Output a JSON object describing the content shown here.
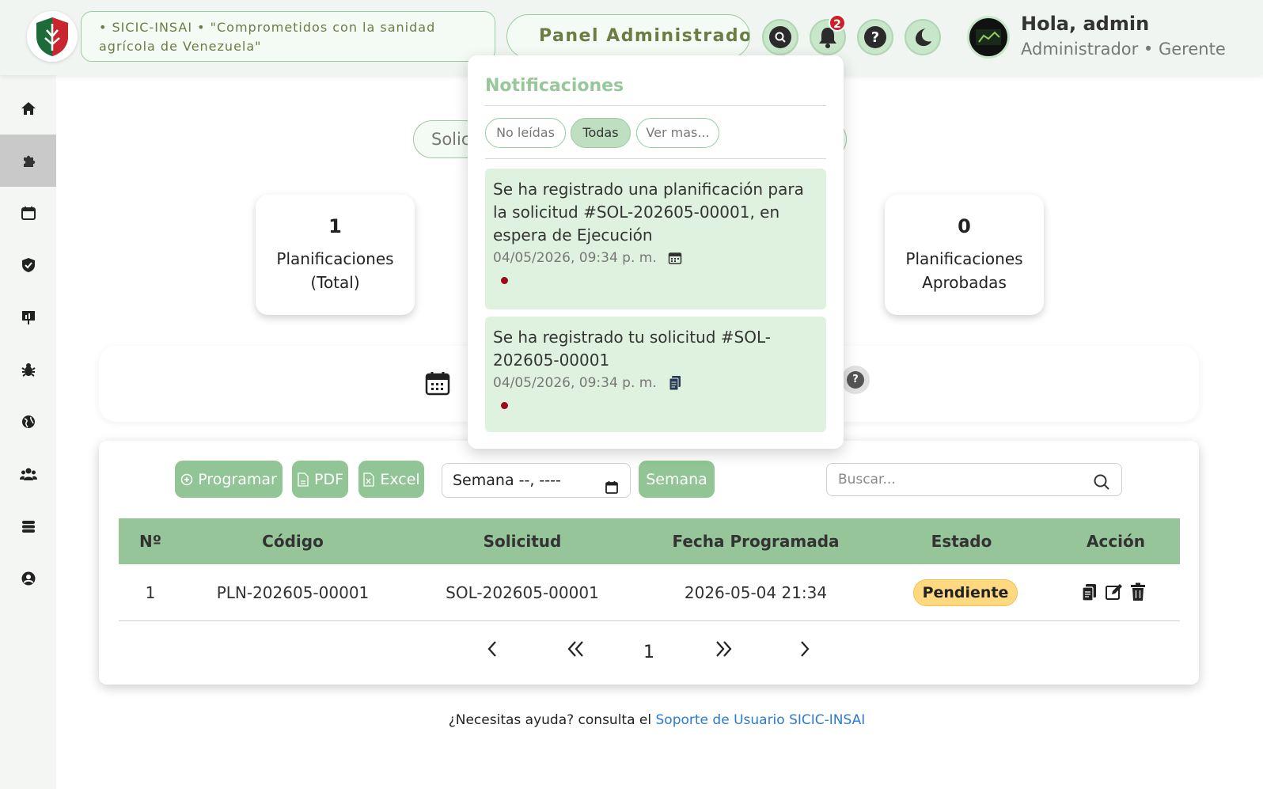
{
  "header": {
    "slogan": "• SICIC-INSAI • \"Comprometidos con la sanidad agrícola de Venezuela\"",
    "panel_title": "Panel Administrador",
    "notification_count": "2",
    "greeting": "Hola, admin",
    "role": "Administrador • Gerente",
    "icons": [
      "search-icon",
      "bell-icon",
      "help-icon",
      "moon-icon"
    ]
  },
  "sidebar": {
    "items": [
      {
        "icon": "home-icon"
      },
      {
        "icon": "puzzle-icon",
        "active": true
      },
      {
        "icon": "calendar-icon"
      },
      {
        "icon": "shield-icon"
      },
      {
        "icon": "presentation-icon"
      },
      {
        "icon": "bug-icon"
      },
      {
        "icon": "globe-icon"
      },
      {
        "icon": "users-icon"
      },
      {
        "icon": "database-icon"
      },
      {
        "icon": "user-circle-icon"
      }
    ]
  },
  "main": {
    "pill_text": "Solic",
    "stats": [
      {
        "value": "1",
        "label_line1": "Planificaciones",
        "label_line2": "(Total)"
      },
      {
        "value": "0",
        "label_line1": "Planificaciones",
        "label_line2": "Aprobadas"
      }
    ]
  },
  "toolbar": {
    "program_label": "Programar",
    "pdf_label": "PDF",
    "excel_label": "Excel",
    "week_value": "Semana --, ----",
    "week_button_label": "Semana",
    "search_placeholder": "Buscar..."
  },
  "table": {
    "headers": [
      "Nº",
      "Código",
      "Solicitud",
      "Fecha Programada",
      "Estado",
      "Acción"
    ],
    "rows": [
      {
        "n": "1",
        "code": "PLN-202605-00001",
        "request": "SOL-202605-00001",
        "date": "2026-05-04 21:34",
        "status": "Pendiente"
      }
    ]
  },
  "pagination": {
    "prev": "‹",
    "first": "«",
    "page": "1",
    "last": "»",
    "next": "›"
  },
  "footer": {
    "text": "¿Necesitas ayuda? consulta el",
    "link": "Soporte de Usuario SICIC-INSAI"
  },
  "notifications": {
    "title": "Notificaciones",
    "tabs": [
      "No leídas",
      "Todas",
      "Ver mas..."
    ],
    "active_tab": "Todas",
    "items": [
      {
        "message": "Se ha registrado una planificación para la solicitud #SOL-202605-00001, en espera de Ejecución",
        "date": "04/05/2026, 09:34 p. m.",
        "icon": "calendar-icon"
      },
      {
        "message": "Se ha registrado tu solicitud #SOL-202605-00001",
        "date": "04/05/2026, 09:34 p. m.",
        "icon": "clipboard-icon"
      }
    ]
  },
  "colors": {
    "accent_green": "#95c598",
    "badge_yellow": "#ffd980",
    "notif_red": "#d11f28",
    "link_blue": "#2b7ad0"
  }
}
